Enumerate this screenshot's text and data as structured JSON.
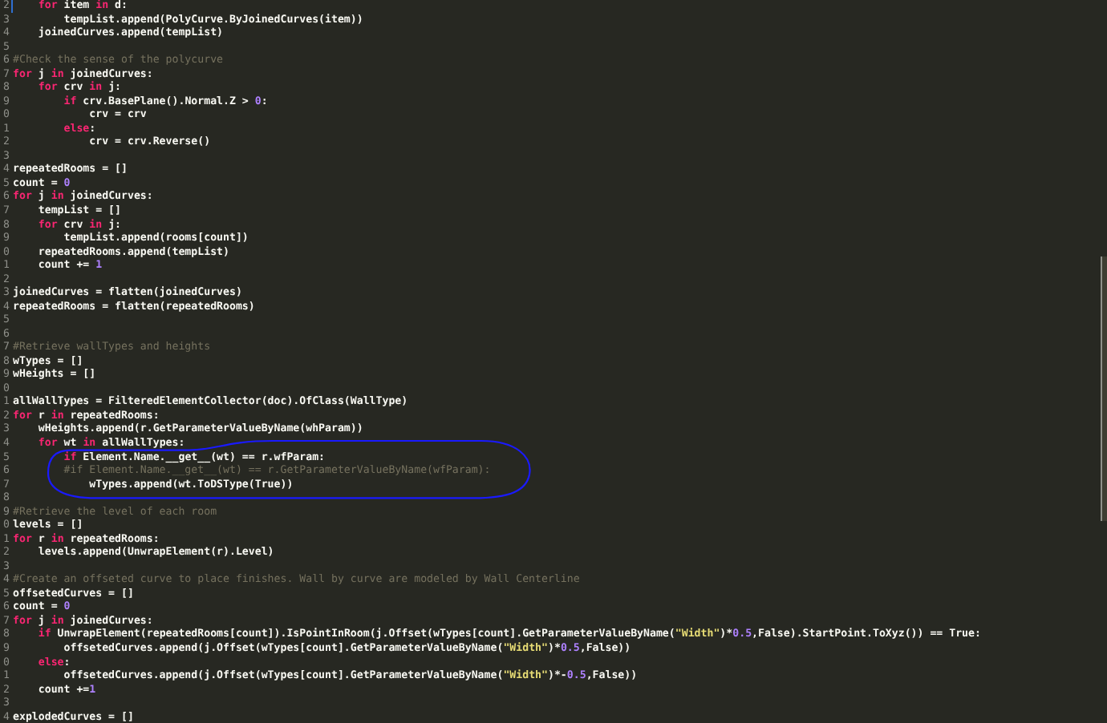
{
  "editor": {
    "lines": [
      {
        "number": "2",
        "tokens": [
          {
            "kind": "keyword",
            "text": "    for"
          },
          {
            "kind": "plain",
            "text": " item "
          },
          {
            "kind": "keyword",
            "text": "in"
          },
          {
            "kind": "plain",
            "text": " d:"
          }
        ]
      },
      {
        "number": "3",
        "tokens": [
          {
            "kind": "plain",
            "text": "        tempList.append(PolyCurve.ByJoinedCurves(item))"
          }
        ]
      },
      {
        "number": "4",
        "tokens": [
          {
            "kind": "plain",
            "text": "    joinedCurves.append(tempList)"
          }
        ]
      },
      {
        "number": "5"
      },
      {
        "number": "6",
        "tokens": [
          {
            "kind": "comment",
            "text": "#Check the sense of the polycurve"
          }
        ]
      },
      {
        "number": "7",
        "tokens": [
          {
            "kind": "keyword",
            "text": "for"
          },
          {
            "kind": "plain",
            "text": " j "
          },
          {
            "kind": "keyword",
            "text": "in"
          },
          {
            "kind": "plain",
            "text": " joinedCurves:"
          }
        ]
      },
      {
        "number": "8",
        "tokens": [
          {
            "kind": "keyword",
            "text": "    for"
          },
          {
            "kind": "plain",
            "text": " crv "
          },
          {
            "kind": "keyword",
            "text": "in"
          },
          {
            "kind": "plain",
            "text": " j:"
          }
        ]
      },
      {
        "number": "9",
        "tokens": [
          {
            "kind": "keyword",
            "text": "        if"
          },
          {
            "kind": "plain",
            "text": " crv.BasePlane().Normal.Z > "
          },
          {
            "kind": "number",
            "text": "0"
          },
          {
            "kind": "plain",
            "text": ":"
          }
        ]
      },
      {
        "number": "0",
        "tokens": [
          {
            "kind": "plain",
            "text": "            crv = crv"
          }
        ]
      },
      {
        "number": "1",
        "tokens": [
          {
            "kind": "keyword",
            "text": "        else"
          },
          {
            "kind": "plain",
            "text": ":"
          }
        ]
      },
      {
        "number": "2",
        "tokens": [
          {
            "kind": "plain",
            "text": "            crv = crv.Reverse()"
          }
        ]
      },
      {
        "number": "3"
      },
      {
        "number": "4",
        "tokens": [
          {
            "kind": "plain",
            "text": "repeatedRooms = []"
          }
        ]
      },
      {
        "number": "5",
        "tokens": [
          {
            "kind": "plain",
            "text": "count = "
          },
          {
            "kind": "number",
            "text": "0"
          }
        ]
      },
      {
        "number": "6",
        "tokens": [
          {
            "kind": "keyword",
            "text": "for"
          },
          {
            "kind": "plain",
            "text": " j "
          },
          {
            "kind": "keyword",
            "text": "in"
          },
          {
            "kind": "plain",
            "text": " joinedCurves:"
          }
        ]
      },
      {
        "number": "7",
        "tokens": [
          {
            "kind": "plain",
            "text": "    tempList = []"
          }
        ]
      },
      {
        "number": "8",
        "tokens": [
          {
            "kind": "keyword",
            "text": "    for"
          },
          {
            "kind": "plain",
            "text": " crv "
          },
          {
            "kind": "keyword",
            "text": "in"
          },
          {
            "kind": "plain",
            "text": " j:"
          }
        ]
      },
      {
        "number": "9",
        "tokens": [
          {
            "kind": "plain",
            "text": "        tempList.append(rooms[count])"
          }
        ]
      },
      {
        "number": "0",
        "tokens": [
          {
            "kind": "plain",
            "text": "    repeatedRooms.append(tempList)"
          }
        ]
      },
      {
        "number": "1",
        "tokens": [
          {
            "kind": "plain",
            "text": "    count += "
          },
          {
            "kind": "number",
            "text": "1"
          }
        ]
      },
      {
        "number": "2"
      },
      {
        "number": "3",
        "tokens": [
          {
            "kind": "plain",
            "text": "joinedCurves = flatten(joinedCurves)"
          }
        ]
      },
      {
        "number": "4",
        "tokens": [
          {
            "kind": "plain",
            "text": "repeatedRooms = flatten(repeatedRooms)"
          }
        ]
      },
      {
        "number": "5"
      },
      {
        "number": "6"
      },
      {
        "number": "7",
        "tokens": [
          {
            "kind": "comment",
            "text": "#Retrieve wallTypes and heights"
          }
        ]
      },
      {
        "number": "8",
        "tokens": [
          {
            "kind": "plain",
            "text": "wTypes = []"
          }
        ]
      },
      {
        "number": "9",
        "tokens": [
          {
            "kind": "plain",
            "text": "wHeights = []"
          }
        ]
      },
      {
        "number": "0"
      },
      {
        "number": "1",
        "tokens": [
          {
            "kind": "plain",
            "text": "allWallTypes = FilteredElementCollector(doc).OfClass(WallType)"
          }
        ]
      },
      {
        "number": "2",
        "tokens": [
          {
            "kind": "keyword",
            "text": "for"
          },
          {
            "kind": "plain",
            "text": " r "
          },
          {
            "kind": "keyword",
            "text": "in"
          },
          {
            "kind": "plain",
            "text": " repeatedRooms:"
          }
        ]
      },
      {
        "number": "3",
        "tokens": [
          {
            "kind": "plain",
            "text": "    wHeights.append(r.GetParameterValueByName(whParam))"
          }
        ]
      },
      {
        "number": "4",
        "tokens": [
          {
            "kind": "keyword",
            "text": "    for"
          },
          {
            "kind": "plain",
            "text": " wt "
          },
          {
            "kind": "keyword",
            "text": "in"
          },
          {
            "kind": "plain",
            "text": " allWallTypes:"
          }
        ]
      },
      {
        "number": "5",
        "tokens": [
          {
            "kind": "keyword",
            "text": "        if"
          },
          {
            "kind": "plain",
            "text": " Element.Name.__get__(wt) == r.wfParam:"
          }
        ]
      },
      {
        "number": "6",
        "tokens": [
          {
            "kind": "comment",
            "text": "        #if Element.Name.__get__(wt) == r.GetParameterValueByName(wfParam):"
          }
        ]
      },
      {
        "number": "7",
        "tokens": [
          {
            "kind": "plain",
            "text": "            wTypes.append(wt.ToDSType(True))"
          }
        ]
      },
      {
        "number": "8"
      },
      {
        "number": "9",
        "tokens": [
          {
            "kind": "comment",
            "text": "#Retrieve the level of each room"
          }
        ]
      },
      {
        "number": "0",
        "tokens": [
          {
            "kind": "plain",
            "text": "levels = []"
          }
        ]
      },
      {
        "number": "1",
        "tokens": [
          {
            "kind": "keyword",
            "text": "for"
          },
          {
            "kind": "plain",
            "text": " r "
          },
          {
            "kind": "keyword",
            "text": "in"
          },
          {
            "kind": "plain",
            "text": " repeatedRooms:"
          }
        ]
      },
      {
        "number": "2",
        "tokens": [
          {
            "kind": "plain",
            "text": "    levels.append(UnwrapElement(r).Level)"
          }
        ]
      },
      {
        "number": "3"
      },
      {
        "number": "4",
        "tokens": [
          {
            "kind": "comment",
            "text": "#Create an offseted curve to place finishes. Wall by curve are modeled by Wall Centerline"
          }
        ]
      },
      {
        "number": "5",
        "tokens": [
          {
            "kind": "plain",
            "text": "offsetedCurves = []"
          }
        ]
      },
      {
        "number": "6",
        "tokens": [
          {
            "kind": "plain",
            "text": "count = "
          },
          {
            "kind": "number",
            "text": "0"
          }
        ]
      },
      {
        "number": "7",
        "tokens": [
          {
            "kind": "keyword",
            "text": "for"
          },
          {
            "kind": "plain",
            "text": " j "
          },
          {
            "kind": "keyword",
            "text": "in"
          },
          {
            "kind": "plain",
            "text": " joinedCurves:"
          }
        ]
      },
      {
        "number": "8",
        "tokens": [
          {
            "kind": "keyword",
            "text": "    if"
          },
          {
            "kind": "plain",
            "text": " UnwrapElement(repeatedRooms[count]).IsPointInRoom(j.Offset(wTypes[count].GetParameterValueByName("
          },
          {
            "kind": "string",
            "text": "\"Width\""
          },
          {
            "kind": "plain",
            "text": ")*"
          },
          {
            "kind": "number",
            "text": "0.5"
          },
          {
            "kind": "plain",
            "text": ",False).StartPoint.ToXyz()) == True:"
          }
        ]
      },
      {
        "number": "9",
        "tokens": [
          {
            "kind": "plain",
            "text": "        offsetedCurves.append(j.Offset(wTypes[count].GetParameterValueByName("
          },
          {
            "kind": "string",
            "text": "\"Width\""
          },
          {
            "kind": "plain",
            "text": ")*"
          },
          {
            "kind": "number",
            "text": "0.5"
          },
          {
            "kind": "plain",
            "text": ",False))"
          }
        ]
      },
      {
        "number": "0",
        "tokens": [
          {
            "kind": "keyword",
            "text": "    else"
          },
          {
            "kind": "plain",
            "text": ":"
          }
        ]
      },
      {
        "number": "1",
        "tokens": [
          {
            "kind": "plain",
            "text": "        offsetedCurves.append(j.Offset(wTypes[count].GetParameterValueByName("
          },
          {
            "kind": "string",
            "text": "\"Width\""
          },
          {
            "kind": "plain",
            "text": ")*-"
          },
          {
            "kind": "number",
            "text": "0.5"
          },
          {
            "kind": "plain",
            "text": ",False))"
          }
        ]
      },
      {
        "number": "2",
        "tokens": [
          {
            "kind": "plain",
            "text": "    count +="
          },
          {
            "kind": "number",
            "text": "1"
          }
        ]
      },
      {
        "number": "3"
      },
      {
        "number": "4",
        "tokens": [
          {
            "kind": "plain",
            "text": "explodedCurves = []"
          }
        ]
      }
    ]
  }
}
